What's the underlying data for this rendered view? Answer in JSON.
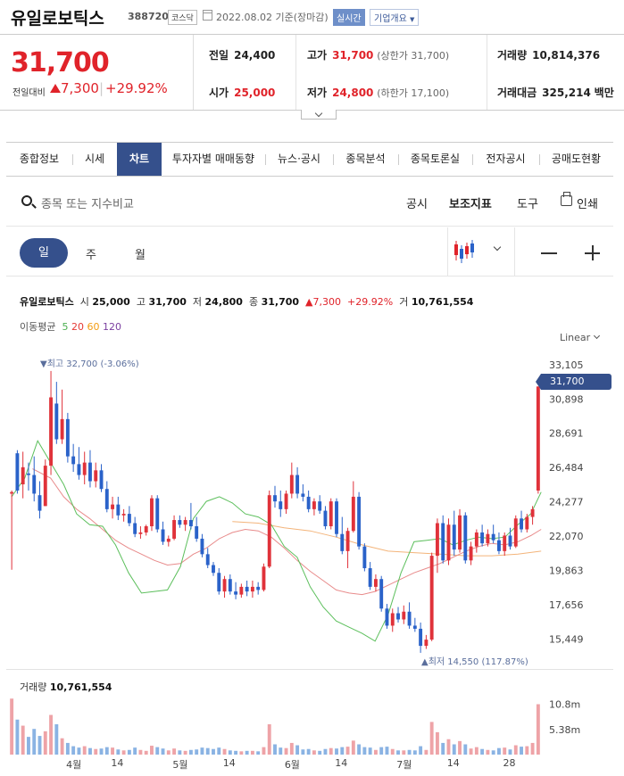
{
  "header": {
    "name": "유일로보틱스",
    "code": "388720",
    "market": "코스닥",
    "date": "2022.08.02",
    "basis": "기준(장마감)",
    "realtime": "실시간",
    "company_info": "기업개요"
  },
  "price": {
    "current": "31,700",
    "change_label": "전일대비",
    "change": "7,300",
    "change_pct": "+29.92%",
    "prev_label": "전일",
    "prev": "24,400",
    "high_label": "고가",
    "high": "31,700",
    "upper_limit": "(상한가 31,700)",
    "volume_label": "거래량",
    "volume": "10,814,376",
    "open_label": "시가",
    "open": "25,000",
    "low_label": "저가",
    "low": "24,800",
    "lower_limit": "(하한가 17,100)",
    "amount_label": "거래대금",
    "amount": "325,214",
    "amount_unit": "백만"
  },
  "tabs": [
    "종합정보",
    "시세",
    "차트",
    "투자자별 매매동향",
    "뉴스·공시",
    "종목분석",
    "종목토론실",
    "전자공시",
    "공매도현황"
  ],
  "active_tab": 2,
  "toolbar": {
    "search_placeholder": "종목 또는 지수비교",
    "disclosure": "공시",
    "indicators": "보조지표",
    "tools": "도구",
    "print": "인쇄"
  },
  "periods": [
    "일",
    "주",
    "월"
  ],
  "chart_info": {
    "name": "유일로보틱스",
    "open_label": "시",
    "open": "25,000",
    "high_label": "고",
    "high": "31,700",
    "low_label": "저",
    "low": "24,800",
    "close_label": "종",
    "close": "31,700",
    "change": "7,300",
    "pct": "+29.92%",
    "vol_label": "거",
    "vol": "10,761,554"
  },
  "ma": {
    "label": "이동평균",
    "items": [
      {
        "label": "5",
        "color": "#4caf50"
      },
      {
        "label": "20",
        "color": "#e53935"
      },
      {
        "label": "60",
        "color": "#f39c12"
      },
      {
        "label": "120",
        "color": "#7b3fa0"
      }
    ]
  },
  "scale": "Linear",
  "annotations": {
    "max": "▼최고 32,700 (-3.06%)",
    "min": "▲최저 14,550 (117.87%)",
    "last_price": "31,700"
  },
  "volume_label": "거래량",
  "volume_value": "10,761,554",
  "chart_data": {
    "type": "candlestick",
    "y_ticks": [
      "33,105",
      "30,898",
      "28,691",
      "26,484",
      "24,277",
      "22,070",
      "19,863",
      "17,656",
      "15,449"
    ],
    "y_tick_values": [
      33105,
      30898,
      28691,
      26484,
      24277,
      22070,
      19863,
      17656,
      15449
    ],
    "ylim": [
      14200,
      33900
    ],
    "volume_ticks": [
      "10.8m",
      "5.38m"
    ],
    "volume_tick_values": [
      10.8,
      5.38
    ],
    "volume_max": 13.0,
    "x_labels": [
      {
        "label": "4월",
        "index": 11
      },
      {
        "label": "14",
        "index": 19
      },
      {
        "label": "5월",
        "index": 30
      },
      {
        "label": "14",
        "index": 39
      },
      {
        "label": "6월",
        "index": 50
      },
      {
        "label": "14",
        "index": 59
      },
      {
        "label": "7월",
        "index": 70
      },
      {
        "label": "14",
        "index": 79
      },
      {
        "label": "28",
        "index": 89
      }
    ],
    "candles": [
      [
        24800,
        25000,
        19900,
        24900,
        12.0
      ],
      [
        27400,
        27600,
        24800,
        25000,
        7.5
      ],
      [
        25400,
        27500,
        24500,
        26500,
        6.2
      ],
      [
        26100,
        26800,
        25000,
        26000,
        3.8
      ],
      [
        26000,
        27200,
        24300,
        24800,
        5.5
      ],
      [
        24700,
        25600,
        23200,
        23700,
        4.0
      ],
      [
        24000,
        27000,
        24000,
        26600,
        5.0
      ],
      [
        26600,
        32700,
        26000,
        31000,
        8.5
      ],
      [
        30600,
        32000,
        28000,
        28300,
        6.5
      ],
      [
        28300,
        31500,
        28000,
        29600,
        3.5
      ],
      [
        29600,
        30000,
        26800,
        27200,
        2.5
      ],
      [
        27200,
        28000,
        26200,
        26700,
        1.8
      ],
      [
        26700,
        27800,
        25700,
        26000,
        1.5
      ],
      [
        26000,
        27500,
        25400,
        26800,
        1.8
      ],
      [
        26800,
        27600,
        25200,
        25600,
        1.4
      ],
      [
        25600,
        26800,
        25200,
        26300,
        1.2
      ],
      [
        26300,
        26700,
        24900,
        25100,
        1.3
      ],
      [
        25100,
        25600,
        23600,
        23800,
        1.6
      ],
      [
        23800,
        24600,
        23200,
        24100,
        1.5
      ],
      [
        24100,
        24600,
        23100,
        23400,
        1.1
      ],
      [
        23400,
        23800,
        23000,
        23500,
        0.9
      ],
      [
        23500,
        24000,
        22700,
        22900,
        1.0
      ],
      [
        22900,
        23300,
        22000,
        22200,
        1.5
      ],
      [
        22200,
        22700,
        21900,
        22300,
        1.0
      ],
      [
        22300,
        22800,
        22100,
        22700,
        0.8
      ],
      [
        22700,
        24700,
        22400,
        24500,
        1.9
      ],
      [
        24500,
        24700,
        22300,
        22500,
        1.6
      ],
      [
        22500,
        23000,
        21500,
        21700,
        1.3
      ],
      [
        21700,
        22100,
        21400,
        21900,
        0.9
      ],
      [
        21900,
        23400,
        21800,
        23100,
        1.3
      ],
      [
        23100,
        23400,
        22600,
        22800,
        0.9
      ],
      [
        22800,
        23300,
        22400,
        23100,
        0.8
      ],
      [
        23100,
        24200,
        22500,
        22700,
        1.0
      ],
      [
        22700,
        23300,
        21700,
        21900,
        1.1
      ],
      [
        21900,
        22200,
        20700,
        20900,
        1.5
      ],
      [
        20900,
        21300,
        20000,
        20200,
        1.4
      ],
      [
        20200,
        20400,
        19500,
        19700,
        1.2
      ],
      [
        19700,
        20000,
        18300,
        18500,
        1.5
      ],
      [
        18500,
        19500,
        18100,
        19300,
        1.2
      ],
      [
        19300,
        19600,
        18300,
        18500,
        0.9
      ],
      [
        18500,
        19100,
        18000,
        18300,
        0.8
      ],
      [
        18300,
        19000,
        18100,
        18800,
        0.7
      ],
      [
        18800,
        19200,
        18200,
        18500,
        0.8
      ],
      [
        18500,
        19200,
        18100,
        18800,
        0.8
      ],
      [
        18800,
        19100,
        18300,
        18600,
        0.7
      ],
      [
        18600,
        20300,
        18500,
        20100,
        1.6
      ],
      [
        20100,
        25000,
        20000,
        24700,
        6.5
      ],
      [
        24700,
        25300,
        23900,
        24300,
        2.2
      ],
      [
        24300,
        25000,
        23300,
        23800,
        1.5
      ],
      [
        23800,
        25000,
        23500,
        24800,
        1.4
      ],
      [
        24800,
        26800,
        24500,
        26000,
        2.5
      ],
      [
        26000,
        26500,
        24500,
        24800,
        2.0
      ],
      [
        24800,
        25400,
        24300,
        24600,
        1.1
      ],
      [
        24600,
        25000,
        23600,
        23800,
        1.2
      ],
      [
        23800,
        24500,
        23400,
        24300,
        0.9
      ],
      [
        24300,
        24700,
        23500,
        23700,
        0.8
      ],
      [
        23700,
        24000,
        22500,
        22700,
        1.2
      ],
      [
        22700,
        24500,
        22500,
        24300,
        1.4
      ],
      [
        24300,
        24500,
        22000,
        22200,
        1.3
      ],
      [
        22200,
        23300,
        20900,
        21100,
        1.6
      ],
      [
        21100,
        22600,
        20000,
        22400,
        1.7
      ],
      [
        22400,
        25600,
        22300,
        24600,
        3.0
      ],
      [
        24600,
        24900,
        21200,
        21400,
        2.2
      ],
      [
        21400,
        21600,
        19800,
        20000,
        1.6
      ],
      [
        20000,
        20400,
        18600,
        18800,
        1.5
      ],
      [
        18800,
        19600,
        18500,
        19300,
        1.0
      ],
      [
        19300,
        19500,
        17200,
        17400,
        1.6
      ],
      [
        17400,
        17700,
        16100,
        16300,
        1.7
      ],
      [
        16300,
        17400,
        15900,
        17100,
        1.2
      ],
      [
        17100,
        17500,
        16500,
        16700,
        0.9
      ],
      [
        16700,
        17600,
        16400,
        17200,
        0.9
      ],
      [
        17200,
        17800,
        16100,
        16300,
        1.0
      ],
      [
        16300,
        16800,
        15900,
        16100,
        0.9
      ],
      [
        16100,
        16500,
        14550,
        15000,
        1.8
      ],
      [
        15000,
        15700,
        14800,
        15400,
        1.0
      ],
      [
        15400,
        21000,
        15300,
        20800,
        7.0
      ],
      [
        20800,
        23200,
        19700,
        22900,
        4.8
      ],
      [
        22900,
        23400,
        20300,
        20500,
        2.5
      ],
      [
        20500,
        23200,
        20200,
        22800,
        3.3
      ],
      [
        22800,
        23700,
        20800,
        21200,
        2.2
      ],
      [
        21200,
        23800,
        21000,
        23400,
        2.9
      ],
      [
        23400,
        23600,
        20300,
        20500,
        2.2
      ],
      [
        20500,
        21700,
        20200,
        21400,
        1.3
      ],
      [
        21400,
        22500,
        21000,
        22300,
        1.6
      ],
      [
        22300,
        22800,
        21400,
        21600,
        1.2
      ],
      [
        21600,
        22500,
        21400,
        22200,
        1.0
      ],
      [
        22200,
        22800,
        21600,
        21800,
        0.9
      ],
      [
        21800,
        22300,
        20900,
        21100,
        1.4
      ],
      [
        21100,
        22300,
        20800,
        22100,
        1.5
      ],
      [
        22100,
        22600,
        21200,
        21400,
        1.1
      ],
      [
        21400,
        23400,
        21300,
        23200,
        2.0
      ],
      [
        23200,
        23700,
        22300,
        22500,
        1.7
      ],
      [
        22500,
        23500,
        22300,
        23300,
        1.8
      ],
      [
        23300,
        24000,
        22800,
        23800,
        2.5
      ],
      [
        25000,
        31700,
        24800,
        31700,
        10.8
      ]
    ],
    "ma5": [
      [
        0,
        24600
      ],
      [
        5,
        25800
      ],
      [
        10,
        28200
      ],
      [
        15,
        26800
      ],
      [
        20,
        25400
      ],
      [
        25,
        23500
      ],
      [
        30,
        22800
      ],
      [
        35,
        22700
      ],
      [
        40,
        21500
      ],
      [
        45,
        19700
      ],
      [
        50,
        18400
      ],
      [
        55,
        18500
      ],
      [
        60,
        18600
      ],
      [
        65,
        20100
      ],
      [
        70,
        23200
      ],
      [
        75,
        24300
      ],
      [
        80,
        24600
      ],
      [
        85,
        24200
      ],
      [
        90,
        23500
      ],
      [
        95,
        23300
      ],
      [
        100,
        22800
      ],
      [
        105,
        21400
      ],
      [
        110,
        20700
      ],
      [
        115,
        18800
      ],
      [
        120,
        17500
      ],
      [
        125,
        16600
      ],
      [
        130,
        16200
      ],
      [
        135,
        15800
      ],
      [
        140,
        15300
      ],
      [
        145,
        17000
      ],
      [
        150,
        19700
      ],
      [
        155,
        21700
      ],
      [
        160,
        21800
      ],
      [
        165,
        21900
      ],
      [
        170,
        21500
      ],
      [
        175,
        21800
      ],
      [
        180,
        22000
      ],
      [
        185,
        21900
      ],
      [
        190,
        22000
      ],
      [
        195,
        22800
      ],
      [
        200,
        23500
      ],
      [
        204,
        24900
      ]
    ],
    "ma20": [
      [
        8,
        26400
      ],
      [
        15,
        25800
      ],
      [
        20,
        24600
      ],
      [
        25,
        23800
      ],
      [
        30,
        23200
      ],
      [
        35,
        22500
      ],
      [
        40,
        21800
      ],
      [
        45,
        21300
      ],
      [
        50,
        20900
      ],
      [
        55,
        20500
      ],
      [
        60,
        20200
      ],
      [
        65,
        20300
      ],
      [
        70,
        20900
      ],
      [
        75,
        21300
      ],
      [
        80,
        21900
      ],
      [
        85,
        22300
      ],
      [
        90,
        22500
      ],
      [
        95,
        22400
      ],
      [
        100,
        22000
      ],
      [
        105,
        21300
      ],
      [
        110,
        20500
      ],
      [
        115,
        19800
      ],
      [
        120,
        19200
      ],
      [
        125,
        18600
      ],
      [
        130,
        18400
      ],
      [
        135,
        18300
      ],
      [
        140,
        18500
      ],
      [
        145,
        18900
      ],
      [
        150,
        19300
      ],
      [
        155,
        19700
      ],
      [
        160,
        20000
      ],
      [
        165,
        20300
      ],
      [
        170,
        20700
      ],
      [
        175,
        21100
      ],
      [
        180,
        21400
      ],
      [
        185,
        21600
      ],
      [
        190,
        21500
      ],
      [
        195,
        21700
      ],
      [
        200,
        22100
      ],
      [
        204,
        22500
      ]
    ],
    "ma60": [
      [
        85,
        23000
      ],
      [
        95,
        22900
      ],
      [
        105,
        22600
      ],
      [
        115,
        22400
      ],
      [
        125,
        22000
      ],
      [
        135,
        21500
      ],
      [
        145,
        21100
      ],
      [
        155,
        21000
      ],
      [
        165,
        20900
      ],
      [
        175,
        20800
      ],
      [
        185,
        20800
      ],
      [
        195,
        20900
      ],
      [
        204,
        21100
      ]
    ]
  }
}
